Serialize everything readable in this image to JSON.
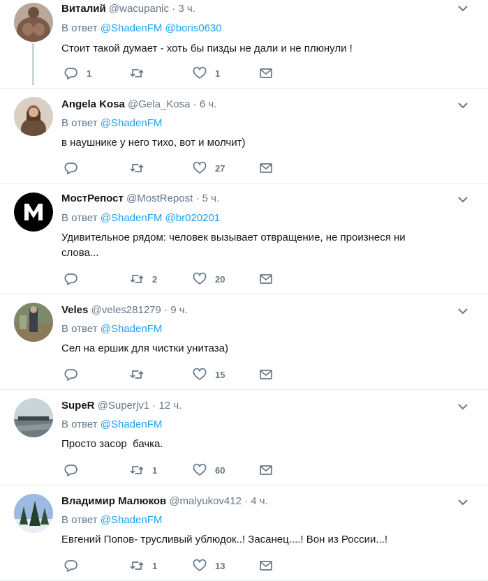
{
  "reply_prefix": "В ответ",
  "tweets": [
    {
      "name": "Виталий",
      "handle": "@wacupanic",
      "time": "3 ч.",
      "mentions": [
        "@ShadenFM",
        "@boris0630"
      ],
      "text": "Стоит такой думает - хоть бы пизды не дали и не плюнули !",
      "replies": "1",
      "retweets": "",
      "likes": "1"
    },
    {
      "name": "Angela Kosa",
      "handle": "@Gela_Kosa",
      "time": "6 ч.",
      "mentions": [
        "@ShadenFM"
      ],
      "text": "в наушнике у него тихо, вот и молчит)",
      "replies": "",
      "retweets": "",
      "likes": "27"
    },
    {
      "name": "МостРепост",
      "handle": "@MostRepost",
      "time": "5 ч.",
      "mentions": [
        "@ShadenFM",
        "@br020201"
      ],
      "text": "Удивительное рядом: человек вызывает отвращение, не произнеся ни слова...",
      "replies": "",
      "retweets": "2",
      "likes": "20"
    },
    {
      "name": "Veles",
      "handle": "@veles281279",
      "time": "9 ч.",
      "mentions": [
        "@ShadenFM"
      ],
      "text": "Сел на ершик для чистки унитаза)",
      "replies": "",
      "retweets": "",
      "likes": "15"
    },
    {
      "name": "SupeR",
      "handle": "@Superjv1",
      "time": "12 ч.",
      "mentions": [
        "@ShadenFM"
      ],
      "text": "Просто засор  бачка.",
      "replies": "",
      "retweets": "1",
      "likes": "60"
    },
    {
      "name": "Владимир Малюков",
      "handle": "@malyukov412",
      "time": "4 ч.",
      "mentions": [
        "@ShadenFM"
      ],
      "text": "Евгений Попов- трусливый ублюдок..! Засанец....! Вон из России...!",
      "replies": "",
      "retweets": "1",
      "likes": "13"
    }
  ],
  "icons": {
    "reply": "reply-icon",
    "retweet": "retweet-icon",
    "like": "heart-icon",
    "dm": "envelope-icon",
    "menu": "chevron-down-icon"
  },
  "colors": {
    "accent": "#1da1f2",
    "muted": "#657786",
    "text": "#14171a",
    "divider": "#e6ecf0",
    "thread_line": "#ccd6dd",
    "avatar_mostrepost": "#000000"
  }
}
